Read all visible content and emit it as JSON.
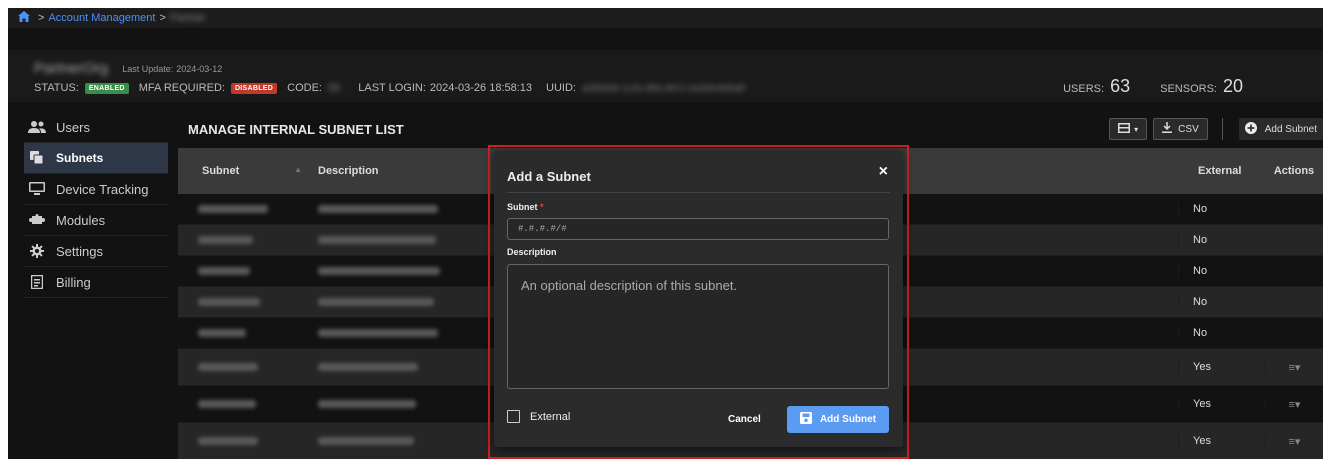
{
  "breadcrumb": {
    "home_icon": "home-icon",
    "separator": ">",
    "account_link": "Account Management",
    "current": "Partner"
  },
  "header": {
    "account_name": "PartnerOrg",
    "last_update_label": "Last Update:",
    "last_update": "2024-03-12",
    "status_label": "STATUS:",
    "status_value": "ENABLED",
    "mfa_label": "MFA REQUIRED:",
    "mfa_value": "DISABLED",
    "code_label": "CODE:",
    "code_value": "00",
    "last_login_label": "LAST LOGIN:",
    "last_login": "2024-03-26 18:58:13",
    "uuid_label": "UUID:",
    "uuid_value": "a1f0b3d2-1c2e-4f5a-9b7c-1e2d3c4b5a6f",
    "users_label": "USERS:",
    "users_count": "63",
    "sensors_label": "SENSORS:",
    "sensors_count": "20"
  },
  "sidebar": {
    "items": [
      {
        "label": "Users",
        "icon": "users-icon"
      },
      {
        "label": "Subnets",
        "icon": "subnets-icon",
        "active": true
      },
      {
        "label": "Device Tracking",
        "icon": "monitor-icon"
      },
      {
        "label": "Modules",
        "icon": "puzzle-icon"
      },
      {
        "label": "Settings",
        "icon": "gear-icon"
      },
      {
        "label": "Billing",
        "icon": "receipt-icon"
      }
    ]
  },
  "main": {
    "title": "MANAGE INTERNAL SUBNET LIST",
    "toolbar": {
      "columns_icon": "columns-icon",
      "csv_label": "CSV",
      "add_label": "Add Subnet"
    },
    "columns": {
      "subnet": "Subnet",
      "description": "Description",
      "external": "External",
      "actions": "Actions"
    },
    "rows": [
      {
        "subnet": "10.0.0.0/8",
        "description": "Default RFC 1918 subnet",
        "external": "No",
        "actions": ""
      },
      {
        "subnet": "192.168.0.0/16",
        "description": "Default RFC 3927 subnet",
        "external": "No",
        "actions": ""
      },
      {
        "subnet": "172.16.0.0/12",
        "description": "Default RFC 1918 subnet",
        "external": "No",
        "actions": ""
      },
      {
        "subnet": "100.64.0.0/10",
        "description": "Default RFC 1918 subnet",
        "external": "No",
        "actions": ""
      },
      {
        "subnet": "fd00::/8",
        "description": "Default RFC 4193 subnet",
        "external": "No",
        "actions": ""
      },
      {
        "subnet": "10.40.100.0/24",
        "description": "Some test network 1",
        "external": "Yes",
        "actions": "≡▾"
      },
      {
        "subnet": "10.50.100.0/24",
        "description": "Some test network 2",
        "external": "Yes",
        "actions": "≡▾"
      },
      {
        "subnet": "10.70.100.0/24",
        "description": "Some test network 3",
        "external": "Yes",
        "actions": "≡▾"
      }
    ]
  },
  "modal": {
    "title": "Add a Subnet",
    "close": "×",
    "subnet_label": "Subnet",
    "required_mark": "*",
    "subnet_placeholder": "#.#.#.#/#",
    "description_label": "Description",
    "description_placeholder": "An optional description of this subnet.",
    "external_label": "External",
    "cancel_label": "Cancel",
    "submit_label": "Add Subnet"
  }
}
